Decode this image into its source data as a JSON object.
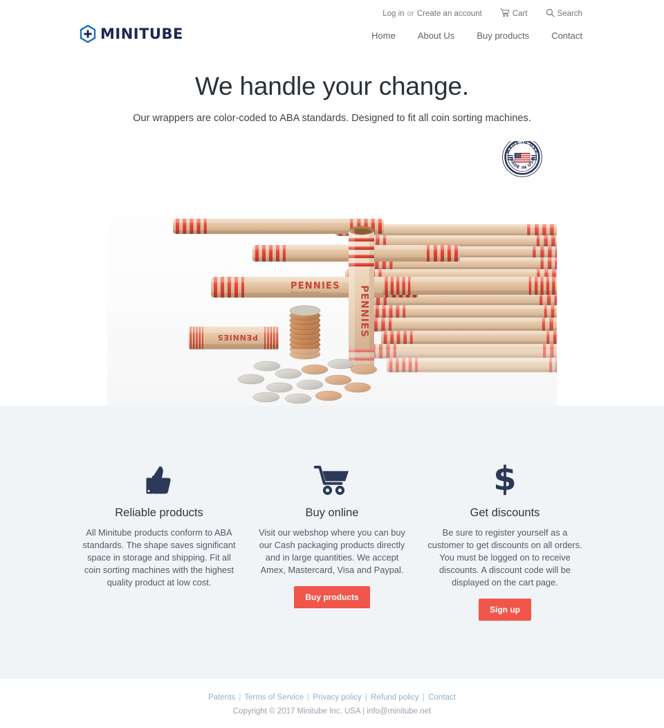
{
  "brand": {
    "name": "MINITUBE",
    "logo_icon": "hexagon-plus-icon",
    "logo_hex_color": "#1d6fb8",
    "wordmark_color": "#1b2653"
  },
  "header": {
    "utility": {
      "login_label": "Log in",
      "or_label": "or",
      "create_account_label": "Create an account",
      "cart_label": "Cart",
      "cart_icon": "shopping-cart-icon",
      "search_label": "Search",
      "search_icon": "magnifying-glass-icon"
    },
    "nav_items": [
      {
        "label": "Home"
      },
      {
        "label": "About Us"
      },
      {
        "label": "Buy products"
      },
      {
        "label": "Contact"
      }
    ]
  },
  "hero": {
    "title": "We handle your change.",
    "subtitle": "Our wrappers are color-coded to ABA standards. Designed to fit all coin sorting machines.",
    "image_alt": "Red striped kraft paper penny coin wrappers with a stack of pennies",
    "wrapper_label": "PENNIES",
    "badge": {
      "icon": "made-in-usa-badge-icon",
      "top_text": "MADE IN USA",
      "bottom_text": "MADE IN USA",
      "flag_icon": "us-flag-icon"
    }
  },
  "features": {
    "items": [
      {
        "icon": "thumbs-up-icon",
        "title": "Reliable products",
        "text": "All Minitube products conform to ABA standards. The shape saves significant space in storage and shipping. Fit all coin sorting machines with the highest quality product at low cost.",
        "cta": null
      },
      {
        "icon": "shopping-cart-icon",
        "title": "Buy online",
        "text": "Visit our webshop where you can buy our Cash packaging products directly and in large quantities. We accept Amex, Mastercard, Visa and Paypal.",
        "cta": "Buy products"
      },
      {
        "icon": "dollar-sign-icon",
        "title": "Get discounts",
        "text": "Be sure to register yourself as a customer to get discounts on all orders. You must be logged on to receive discounts. A discount code will be displayed on the cart page.",
        "cta": "Sign up"
      }
    ]
  },
  "footer": {
    "links": [
      {
        "label": "Patents"
      },
      {
        "label": "Terms of Service"
      },
      {
        "label": "Privacy policy"
      },
      {
        "label": "Refund policy"
      },
      {
        "label": "Contact"
      }
    ],
    "separator": "|",
    "copyright_prefix": "Copyright © 2017 Minitube Inc. USA",
    "copyright_separator": "|",
    "email": "info@minitube.net"
  },
  "colors": {
    "accent": "#f0564a",
    "navy": "#2c3858",
    "section_bg": "#f1f4f7",
    "footer_link": "#8fb0cf"
  }
}
